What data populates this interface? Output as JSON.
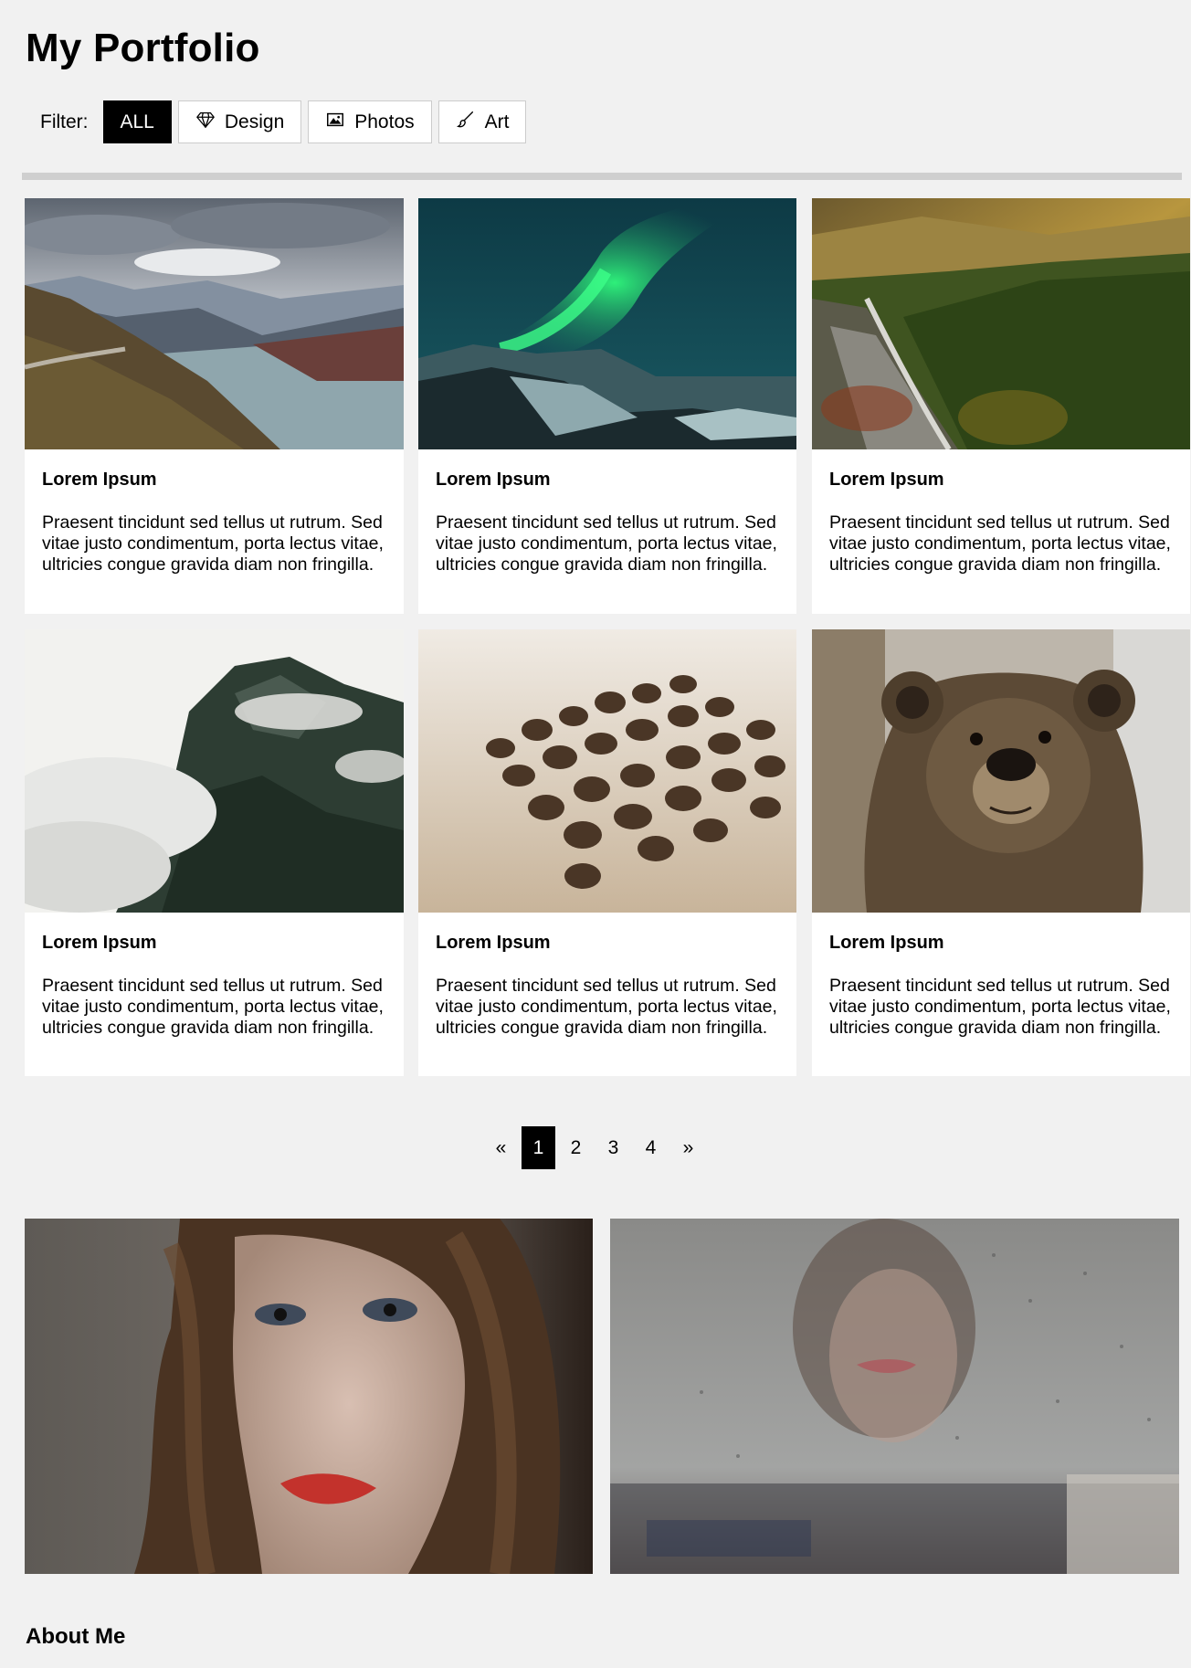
{
  "page": {
    "title": "My Portfolio"
  },
  "filter": {
    "label": "Filter:",
    "buttons": [
      {
        "label": "ALL",
        "icon": "",
        "active": true
      },
      {
        "label": "Design",
        "icon": "diamond-icon",
        "active": false
      },
      {
        "label": "Photos",
        "icon": "image-icon",
        "active": false
      },
      {
        "label": "Art",
        "icon": "brush-icon",
        "active": false
      }
    ]
  },
  "cards": [
    {
      "title": "Lorem Ipsum",
      "text": "Praesent tincidunt sed tellus ut rutrum. Sed vitae justo condimentum, porta lectus vitae, ultricies congue gravida diam non fringilla.",
      "image": "mountain lake"
    },
    {
      "title": "Lorem Ipsum",
      "text": "Praesent tincidunt sed tellus ut rutrum. Sed vitae justo condimentum, porta lectus vitae, ultricies congue gravida diam non fringilla.",
      "image": "northern lights"
    },
    {
      "title": "Lorem Ipsum",
      "text": "Praesent tincidunt sed tellus ut rutrum. Sed vitae justo condimentum, porta lectus vitae, ultricies congue gravida diam non fringilla.",
      "image": "forest valley"
    },
    {
      "title": "Lorem Ipsum",
      "text": "Praesent tincidunt sed tellus ut rutrum. Sed vitae justo condimentum, porta lectus vitae, ultricies congue gravida diam non fringilla.",
      "image": "misty mountain"
    },
    {
      "title": "Lorem Ipsum",
      "text": "Praesent tincidunt sed tellus ut rutrum. Sed vitae justo condimentum, porta lectus vitae, ultricies congue gravida diam non fringilla.",
      "image": "coffee beans"
    },
    {
      "title": "Lorem Ipsum",
      "text": "Praesent tincidunt sed tellus ut rutrum. Sed vitae justo condimentum, porta lectus vitae, ultricies congue gravida diam non fringilla.",
      "image": "bear"
    }
  ],
  "pagination": {
    "prev": "«",
    "pages": [
      "1",
      "2",
      "3",
      "4"
    ],
    "current": "1",
    "next": "»"
  },
  "about": {
    "heading": "About Me"
  },
  "colors": {
    "background": "#f1f1f1",
    "active": "#000000",
    "card": "#ffffff"
  }
}
